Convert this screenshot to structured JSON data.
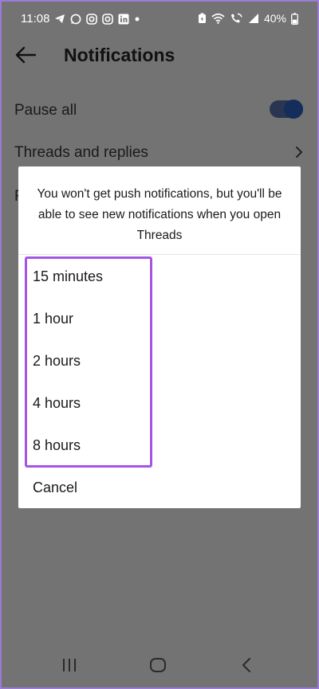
{
  "status_bar": {
    "time": "11:08",
    "battery": "40%",
    "icons": [
      "telegram-icon",
      "whatsapp-icon",
      "instagram-icon",
      "instagram-icon",
      "linkedin-icon",
      "dot-icon",
      "battery-saver-icon",
      "wifi-icon",
      "wifi-calling-icon",
      "signal-icon",
      "battery-icon"
    ]
  },
  "header": {
    "title": "Notifications"
  },
  "settings": {
    "pause_all_label": "Pause all",
    "pause_all_on": true,
    "threads_label": "Threads and replies",
    "partial_label": "F"
  },
  "dialog": {
    "message": "You won't get push notifications, but you'll be able to see new notifications when you open Threads",
    "options": [
      {
        "label": "15 minutes"
      },
      {
        "label": "1 hour"
      },
      {
        "label": "2 hours"
      },
      {
        "label": "4 hours"
      },
      {
        "label": "8 hours"
      }
    ],
    "cancel_label": "Cancel"
  },
  "colors": {
    "scrim": "#737373",
    "highlight": "#a455e6",
    "toggle_on": "#142d5a"
  }
}
